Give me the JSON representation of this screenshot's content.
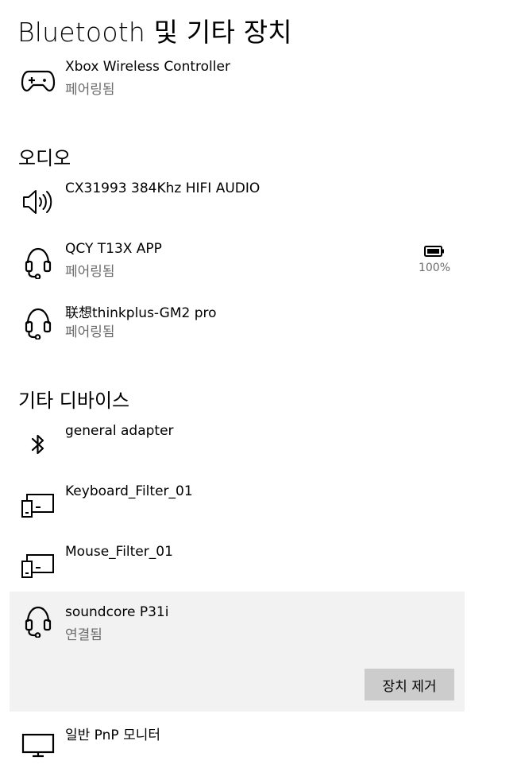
{
  "title": "Bluetooth 및 기타 장치",
  "sections": {
    "audio": "오디오",
    "other": "기타 디바이스"
  },
  "devices": {
    "xbox": {
      "name": "Xbox Wireless Controller",
      "status": "페어링됨",
      "icon": "gamepad-icon"
    },
    "cx31993": {
      "name": "CX31993 384Khz HIFI AUDIO",
      "icon": "speaker-icon"
    },
    "qcy": {
      "name": "QCY T13X APP",
      "status": "페어링됨",
      "battery": "100%",
      "icon": "headset-icon"
    },
    "lenovo": {
      "name": "联想thinkplus-GM2 pro",
      "status": "페어링됨",
      "icon": "headset-icon"
    },
    "general": {
      "name": "general adapter",
      "icon": "bluetooth-icon"
    },
    "keyboard_filter": {
      "name": "Keyboard_Filter_01",
      "icon": "device-icon"
    },
    "mouse_filter": {
      "name": "Mouse_Filter_01",
      "icon": "device-icon"
    },
    "soundcore": {
      "name": "soundcore P31i",
      "status": "연결됨",
      "remove_label": "장치 제거",
      "icon": "headset-icon"
    },
    "monitor": {
      "name": "일반 PnP 모니터",
      "icon": "monitor-icon"
    }
  },
  "colors": {
    "selected_background": "#f2f2f2",
    "button_background": "#cccccc",
    "status_text": "#6b6b6b"
  }
}
